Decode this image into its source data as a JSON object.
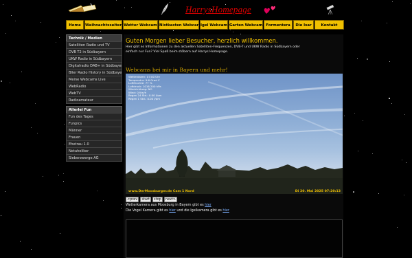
{
  "header": {
    "title": "HarrysHomepage",
    "icons": [
      "book-icon",
      "feather-icon",
      "hearts-icon",
      "telescope-icon"
    ]
  },
  "nav": {
    "items": [
      "Home",
      "Weihnachtsseiten",
      "Wetter Webcam",
      "Nistkasten Webcam",
      "Igel Webcam",
      "Garten Webcam",
      "Formentera",
      "Die Isar",
      "Kontakt"
    ]
  },
  "sidebar": {
    "section1_title": "Technik / Medien",
    "section1_items": [
      "Satelliten Radio und TV",
      "DVB T2 in Südbayern",
      "UKW Radio in Südbayern",
      "Digitalradio DAB+ in Südbayern",
      "Bller Radio History in Südbayern",
      "Meine Webcams Live",
      "WebRadio",
      "WebTV",
      "Radioamateur"
    ],
    "section2_title": "Allerlei Fun",
    "section2_items": [
      "Fun des Tages",
      "Funpics",
      "Männer",
      "Frauen",
      "Ehetrau 1.0",
      "Netaholiker",
      "Sieberzwerge AG"
    ]
  },
  "main": {
    "welcome": "Guten Morgen lieber Besucher, herzlich willkommen.",
    "intro": "Hier gibt es Informationen zu den aktuellen Satelliten-Frequenzen, DVB-T und UKW Radio in Südbayern oder einfach nur Fun? Viel Spaß beim stöbern auf Harrys Homepage.",
    "webcam_title": "Webcams bei mir in Bayern und mehr!",
    "cam_data": [
      "Wetterdaten: 07:00 Uhr",
      "Temperatur: 9.6 Grad C",
      "Luftfeuchte: 77 %",
      "Luftdruck: 1016.200 hPa",
      "Windrichtung: NO",
      "Wind: 0 Km/h",
      "Regen 24 Std.: 0.00 l/qm",
      "Regen 1 Std.: 0.00 l/qm"
    ],
    "cam_caption_left": "www.DerMoosburger.de Cam 1 Nord",
    "cam_caption_right": "Di 20. Mai 2025  07:20:13",
    "controls": [
      "<prev",
      "start",
      "stop",
      "next>"
    ],
    "line1_text": "Wetterkamera aus Moosburg in Bayern gibt es",
    "line1_link": "hier",
    "line2_a": "Die Vogel Kamera gibt es",
    "line2_link1": "hier",
    "line2_b": "und die Igelkamera gibt es",
    "line2_link2": "hier"
  }
}
